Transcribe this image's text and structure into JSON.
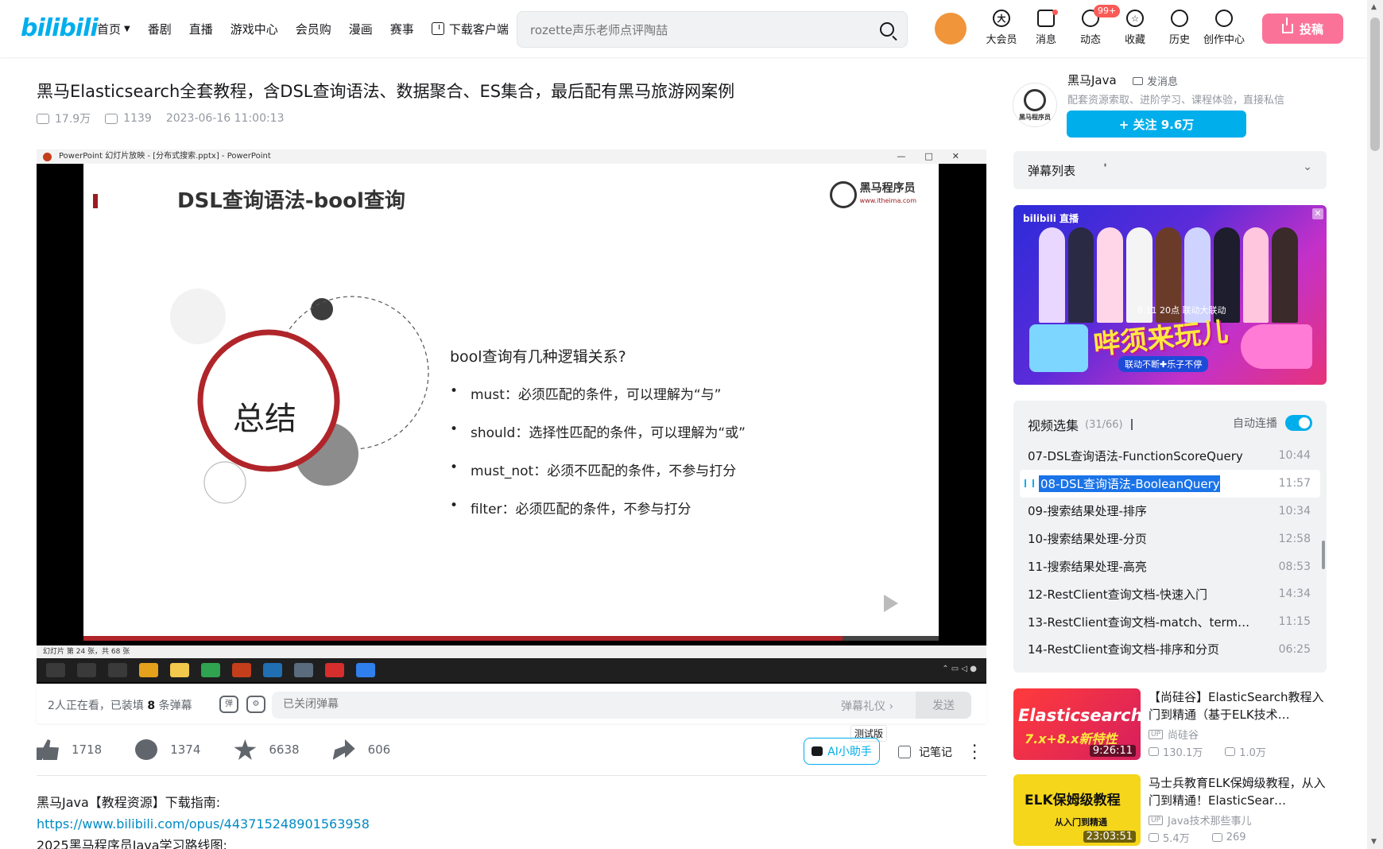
{
  "header": {
    "logo": "bilibili",
    "nav": [
      {
        "label": "首页",
        "chevron": true
      },
      {
        "label": "番剧"
      },
      {
        "label": "直播"
      },
      {
        "label": "游戏中心"
      },
      {
        "label": "会员购"
      },
      {
        "label": "漫画"
      },
      {
        "label": "赛事"
      },
      {
        "label": "下载客户端",
        "icon": "download-icon"
      }
    ],
    "search": {
      "value": "",
      "placeholder": "rozette声乐老师点评陶喆"
    },
    "icons": [
      {
        "name": "vip-icon",
        "label": "大会员"
      },
      {
        "name": "message-icon",
        "label": "消息",
        "dot": true
      },
      {
        "name": "dynamic-icon",
        "label": "动态",
        "badge": "99+"
      },
      {
        "name": "favorite-icon",
        "label": "收藏"
      },
      {
        "name": "history-icon",
        "label": "历史"
      },
      {
        "name": "creator-icon",
        "label": "创作中心"
      }
    ],
    "upload_label": "投稿"
  },
  "video": {
    "title": "黑马Elasticsearch全套教程，含DSL查询语法、数据聚合、ES集合，最后配有黑马旅游网案例",
    "views": "17.9万",
    "danmaku_count": "1139",
    "date": "2023-06-16 11:00:13"
  },
  "player": {
    "window_title": "PowerPoint 幻灯片放映 - [分布式搜索.pptx] - PowerPoint",
    "slide": {
      "title": "DSL查询语法-bool查询",
      "logo_name": "黑马程序员",
      "logo_url": "www.itheima.com",
      "summary": "总结",
      "question": "bool查询有几种逻辑关系?",
      "bullets": [
        "must：必须匹配的条件，可以理解为“与”",
        "should：选择性匹配的条件，可以理解为“或”",
        "must_not：必须不匹配的条件，不参与打分",
        "filter：必须匹配的条件，不参与打分"
      ],
      "bullet_mark": "•",
      "progress": 0.888
    },
    "status": "幻灯片 第 24 张，共 68 张"
  },
  "danmaku_bar": {
    "viewers_prefix": "2人正在看，已装填",
    "count": "8",
    "suffix": "条弹幕",
    "placeholder": "已关闭弹幕",
    "gift": "弹幕礼仪 ›",
    "send": "发送"
  },
  "actions": {
    "like": "1718",
    "coin": "1374",
    "favorite": "6638",
    "share": "606",
    "ai_label": "AI小助手",
    "beta": "测试版",
    "note": "记笔记"
  },
  "description": {
    "line1": "黑马Java【教程资源】下载指南:",
    "link": "https://www.bilibili.com/opus/443715248901563958",
    "line3": "2025黑马程序员Java学习路线图:"
  },
  "uploader": {
    "name": "黑马Java",
    "msg": "发消息",
    "desc": "配套资源索取、进阶学习、课程体验，直接私信",
    "follow": "+ 关注 9.6万",
    "avatar_text": "黑马程序员"
  },
  "danmaku_list": {
    "title": "弹幕列表"
  },
  "banner": {
    "label": "bilibili 直播",
    "slogan": "哔须来玩儿",
    "sub": "联动不断✚乐子不停",
    "date": "8.11 20点 联动大联动"
  },
  "playlist": {
    "title": "视频选集",
    "count": "(31/66)",
    "autoplay": "自动连播",
    "items": [
      {
        "name": "07-DSL查询语法-FunctionScoreQuery",
        "dur": "10:44"
      },
      {
        "name": "08-DSL查询语法-BooleanQuery",
        "dur": "11:57",
        "active": true
      },
      {
        "name": "09-搜索结果处理-排序",
        "dur": "10:34"
      },
      {
        "name": "10-搜索结果处理-分页",
        "dur": "12:58"
      },
      {
        "name": "11-搜索结果处理-高亮",
        "dur": "08:53"
      },
      {
        "name": "12-RestClient查询文档-快速入门",
        "dur": "14:34"
      },
      {
        "name": "13-RestClient查询文档-match、term…",
        "dur": "11:15"
      },
      {
        "name": "14-RestClient查询文档-排序和分页",
        "dur": "06:25"
      }
    ]
  },
  "recommendations": [
    {
      "title": "【尚硅谷】ElasticSearch教程入门到精通（基于ELK技术…",
      "thumb_text": "Elasticsearch",
      "thumb_sub": "7.x+8.x新特性",
      "duration": "9:26:11",
      "author": "尚硅谷",
      "views": "130.1万",
      "danmaku": "1.0万"
    },
    {
      "title": "马士兵教育ELK保姆级教程，从入门到精通！ElasticSear…",
      "thumb_text": "ELK保姆级教程",
      "thumb_sub": "从入门到精通",
      "duration": "23:03:51",
      "author": "Java技术那些事儿",
      "views": "5.4万",
      "danmaku": "269"
    }
  ]
}
